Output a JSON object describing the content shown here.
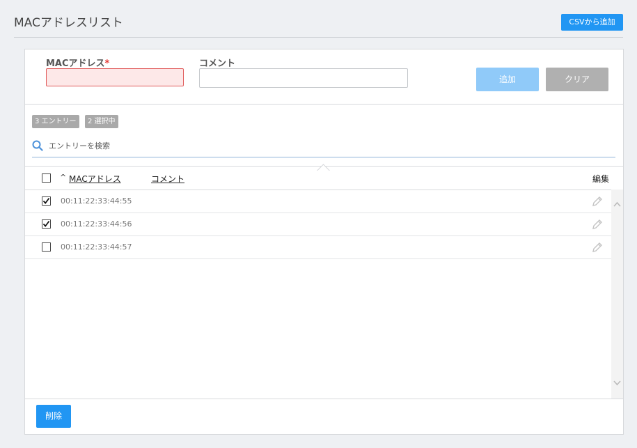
{
  "page": {
    "title": "MACアドレスリスト"
  },
  "toolbar": {
    "csv_button": "CSVから追加"
  },
  "form": {
    "mac_label": "MACアドレス",
    "mac_required_mark": "*",
    "mac_value": "",
    "comment_label": "コメント",
    "comment_value": "",
    "add_button": "追加",
    "clear_button": "クリア"
  },
  "badges": {
    "entries": "3 エントリー",
    "selected": "2 選択中"
  },
  "search": {
    "placeholder": "エントリーを検索",
    "icon": "search-icon"
  },
  "table": {
    "headers": {
      "mac": "MACアドレス",
      "comment": "コメント",
      "edit": "編集"
    },
    "sort": {
      "column": "mac",
      "direction": "ascending"
    },
    "rows": [
      {
        "checked": true,
        "mac": "00:11:22:33:44:55",
        "comment": ""
      },
      {
        "checked": true,
        "mac": "00:11:22:33:44:56",
        "comment": ""
      },
      {
        "checked": false,
        "mac": "00:11:22:33:44:57",
        "comment": ""
      }
    ]
  },
  "footer": {
    "delete_button": "削除"
  },
  "colors": {
    "primary": "#2196f3",
    "primary_disabled": "#90caf9",
    "secondary": "#b0b0b0",
    "error_border": "#e05a5a",
    "error_bg": "#fde8e8",
    "badge": "#a9a9a9"
  }
}
